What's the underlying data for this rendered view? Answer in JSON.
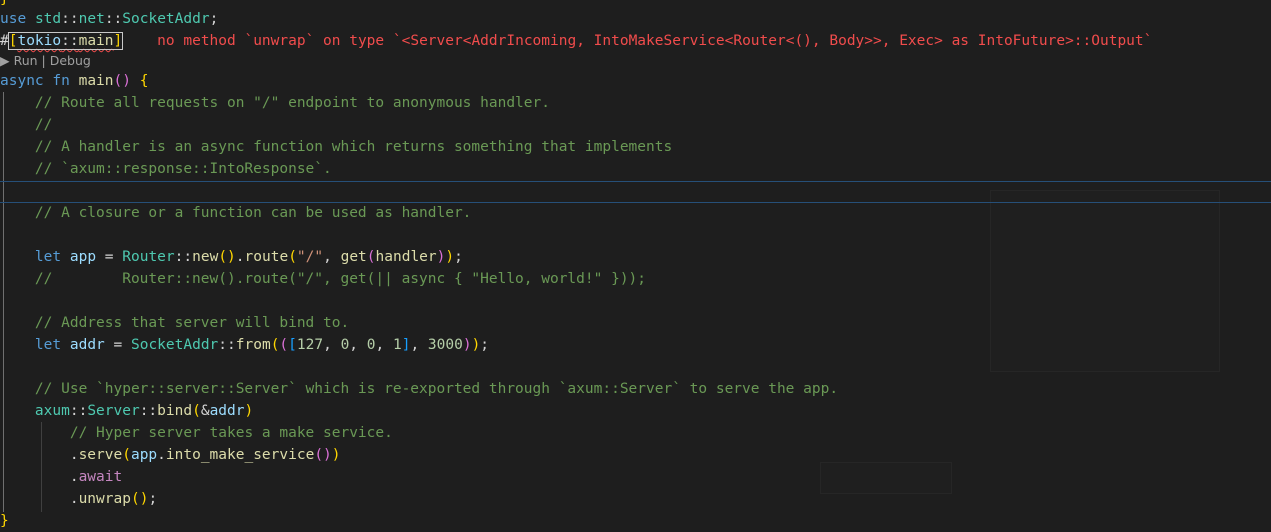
{
  "editor": {
    "lines": {
      "l0": "}",
      "l1": {
        "kw_use": "use",
        "path1": "std",
        "sep1": "::",
        "path2": "net",
        "sep2": "::",
        "type": "SocketAddr",
        "semi": ";"
      },
      "l2": {
        "hash": "#",
        "open": "[",
        "tokio": "tokio",
        "sep": "::",
        "main": "main",
        "close": "]",
        "error": "no method `unwrap` on type `<Server<AddrIncoming, IntoMakeService<Router<(), Body>>, Exec> as IntoFuture>::Output`"
      },
      "codelens": "▶ Run | Debug",
      "l3": {
        "async": "async",
        "fn": "fn",
        "name": "main",
        "parens": "()",
        "brace": "{"
      },
      "l4": "// Route all requests on \"/\" endpoint to anonymous handler.",
      "l5": "//",
      "l6": "// A handler is an async function which returns something that implements",
      "l7": "// `axum::response::IntoResponse`.",
      "l8": "",
      "l9": "// A closure or a function can be used as handler.",
      "l11": {
        "let": "let",
        "app": "app",
        "eq": " = ",
        "router": "Router",
        "sep": "::",
        "new": "new",
        "p1": "()",
        "dot": ".",
        "route": "route",
        "po": "(",
        "str": "\"/\"",
        "comma": ", ",
        "get": "get",
        "go": "(",
        "handler": "handler",
        "gc": ")",
        "pc": ")",
        "semi": ";"
      },
      "l12": "//        Router::new().route(\"/\", get(|| async { \"Hello, world!\" }));",
      "l14": "// Address that server will bind to.",
      "l15": {
        "let": "let",
        "addr": "addr",
        "eq": " = ",
        "type": "SocketAddr",
        "sep": "::",
        "from": "from",
        "o1": "(",
        "o2": "(",
        "o3": "[",
        "n1": "127",
        "c1": ", ",
        "n2": "0",
        "c2": ", ",
        "n3": "0",
        "c3": ", ",
        "n4": "1",
        "cl3": "]",
        "c4": ", ",
        "n5": "3000",
        "cl2": ")",
        "cl1": ")",
        "semi": ";"
      },
      "l17": "// Use `hyper::server::Server` which is re-exported through `axum::Server` to serve the app.",
      "l18": {
        "axum": "axum",
        "sep1": "::",
        "server": "Server",
        "sep2": "::",
        "bind": "bind",
        "o": "(",
        "amp": "&",
        "addr": "addr",
        "c": ")"
      },
      "l19": "// Hyper server takes a make service.",
      "l20": {
        "dot": ".",
        "serve": "serve",
        "o": "(",
        "app": "app",
        "dot2": ".",
        "ims": "into_make_service",
        "p": "()",
        "c": ")"
      },
      "l21": {
        "dot": ".",
        "await": "await"
      },
      "l22": {
        "dot": ".",
        "unwrap": "unwrap",
        "p": "()",
        "semi": ";"
      },
      "l23": "}"
    }
  },
  "colors": {
    "background": "#1e1e1e",
    "keyword": "#569cd6",
    "type": "#4ec9b0",
    "function": "#dcdcaa",
    "variable": "#9cdcfe",
    "string": "#ce9178",
    "number": "#b5cea8",
    "comment": "#6a9955",
    "error": "#f14c4c"
  }
}
